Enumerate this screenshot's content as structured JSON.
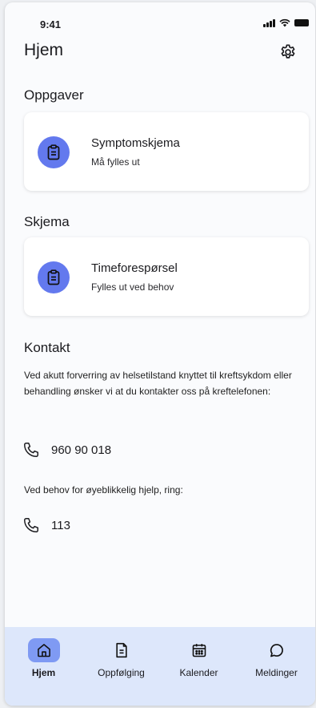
{
  "status_bar": {
    "time": "9:41"
  },
  "header": {
    "title": "Hjem"
  },
  "tasks_section": {
    "title": "Oppgaver",
    "card": {
      "title": "Symptomskjema",
      "subtitle": "Må fylles ut",
      "icon": "clipboard-icon"
    }
  },
  "forms_section": {
    "title": "Skjema",
    "card": {
      "title": "Timeforespørsel",
      "subtitle": "Fylles ut ved behov",
      "icon": "clipboard-icon"
    }
  },
  "contact": {
    "title": "Kontakt",
    "text_1": "Ved akutt forverring av helsetilstand knyttet til kreftsykdom eller behandling ønsker vi at du kontakter oss på kreftelefonen:",
    "phone_1": "960 90 018",
    "text_2": "Ved behov for øyeblikkelig hjelp, ring:",
    "phone_2": "113"
  },
  "bottom_nav": {
    "items": [
      {
        "label": "Hjem",
        "icon": "home-icon",
        "active": true
      },
      {
        "label": "Oppfølging",
        "icon": "document-icon",
        "active": false
      },
      {
        "label": "Kalender",
        "icon": "calendar-icon",
        "active": false
      },
      {
        "label": "Meldinger",
        "icon": "chat-icon",
        "active": false
      }
    ]
  },
  "colors": {
    "accent": "#6379ee",
    "nav_background": "#dde7fb",
    "nav_active": "#7f9af3"
  }
}
